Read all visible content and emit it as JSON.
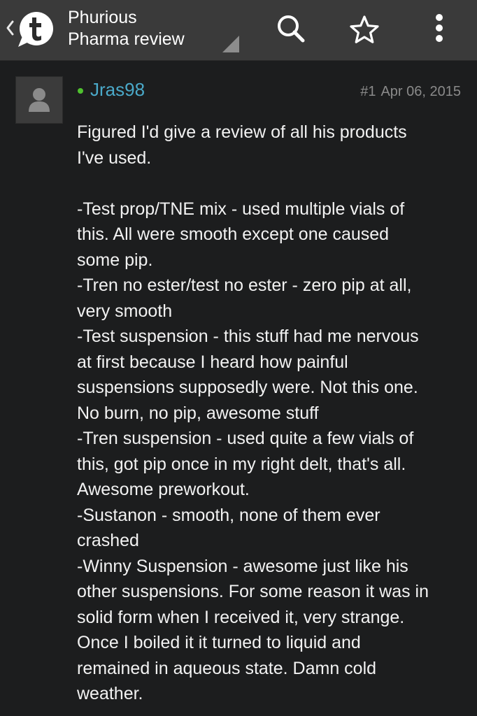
{
  "header": {
    "title_line1": "Phurious",
    "title_line2": "Pharma review",
    "logo_icon": "tapatalk-logo-icon",
    "back_icon": "chevron-left-icon",
    "actions": [
      {
        "name": "search",
        "icon": "search-icon"
      },
      {
        "name": "bookmark",
        "icon": "star-icon"
      },
      {
        "name": "more",
        "icon": "overflow-menu-icon"
      }
    ],
    "colors": {
      "bar": "#3a3a3a",
      "background": "#1c1d1e"
    }
  },
  "post": {
    "username": "Jras98",
    "online": true,
    "number": "#1",
    "date": "Apr 06, 2015",
    "colors": {
      "username": "#4aa9c9",
      "online": "#4fc12f",
      "meta": "#8a8a8a"
    },
    "body_lines": [
      "Figured I'd give a review of all his products",
      "I've used.",
      "",
      "-Test prop/TNE mix - used multiple vials of",
      "this. All were smooth except one caused",
      "some pip.",
      "-Tren no ester/test no ester - zero pip at all,",
      "very smooth",
      "-Test suspension - this stuff had me nervous",
      "at first because I heard how painful",
      "suspensions supposedly were. Not this one.",
      "No burn, no pip, awesome stuff",
      "-Tren suspension - used quite a few vials of",
      "this, got pip once in my right delt, that's all.",
      "Awesome preworkout.",
      "-Sustanon - smooth, none of them ever",
      "crashed",
      "-Winny Suspension - awesome just like his",
      "other suspensions. For some reason it was in",
      "solid form when I received it, very strange.",
      "Once I boiled it it turned to liquid and",
      "remained in aqueous state. Damn cold",
      "weather."
    ]
  }
}
